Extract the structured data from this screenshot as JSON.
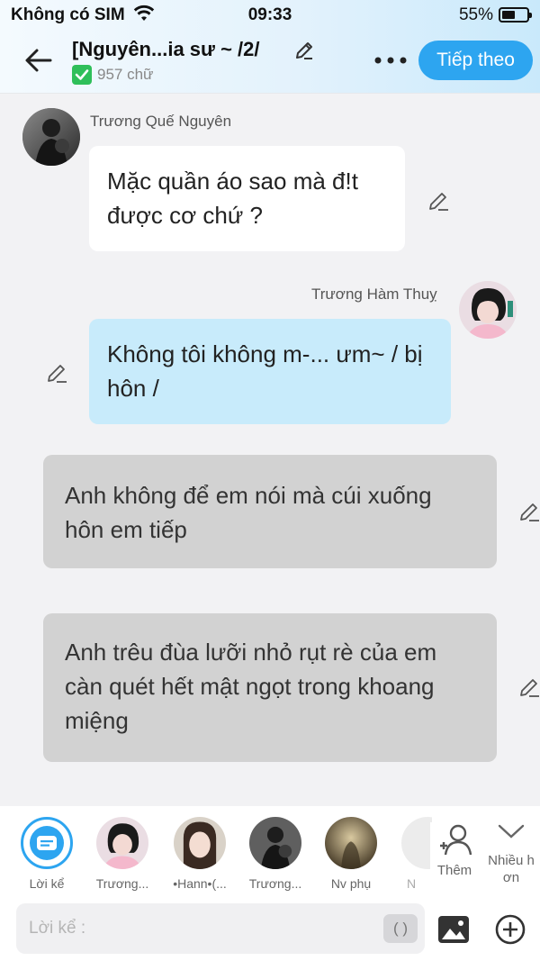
{
  "status_bar": {
    "carrier": "Không có SIM",
    "time": "09:33",
    "battery": "55%"
  },
  "header": {
    "title": "[Nguyên...ia sư ~ /2/",
    "word_count": "957 chữ",
    "next_button": "Tiếp theo",
    "accent_color": "#2da5f0"
  },
  "messages": [
    {
      "speaker": "Trương Quế Nguyên",
      "text": "Mặc quần áo sao mà đ!t được cơ chứ ?",
      "side": "left",
      "color": "#ffffff"
    },
    {
      "speaker": "Trương Hàm Thuỵ",
      "text": "Không tôi không m-... ưm~ / bị hôn /",
      "side": "right",
      "color": "#c8ebfb"
    },
    {
      "speaker": "",
      "text": "Anh không để em nói mà cúi xuống hôn em tiếp",
      "side": "narration",
      "color": "#d2d2d2"
    },
    {
      "speaker": "",
      "text": "Anh trêu đùa lưỡi nhỏ rụt rè của em càn quét hết mật ngọt trong khoang miệng",
      "side": "narration",
      "color": "#d2d2d2"
    }
  ],
  "characters": [
    {
      "label": "Lời kể",
      "icon": "narration-icon",
      "selected": true
    },
    {
      "label": "Trương..."
    },
    {
      "label": "•Hann•(..."
    },
    {
      "label": "Trương..."
    },
    {
      "label": "Nv phụ"
    },
    {
      "label": "N"
    }
  ],
  "actions": {
    "add_label": "Thêm",
    "more_label": "Nhiều h ơn"
  },
  "composer": {
    "placeholder": "Lời kể :",
    "paren_button": "( )"
  }
}
